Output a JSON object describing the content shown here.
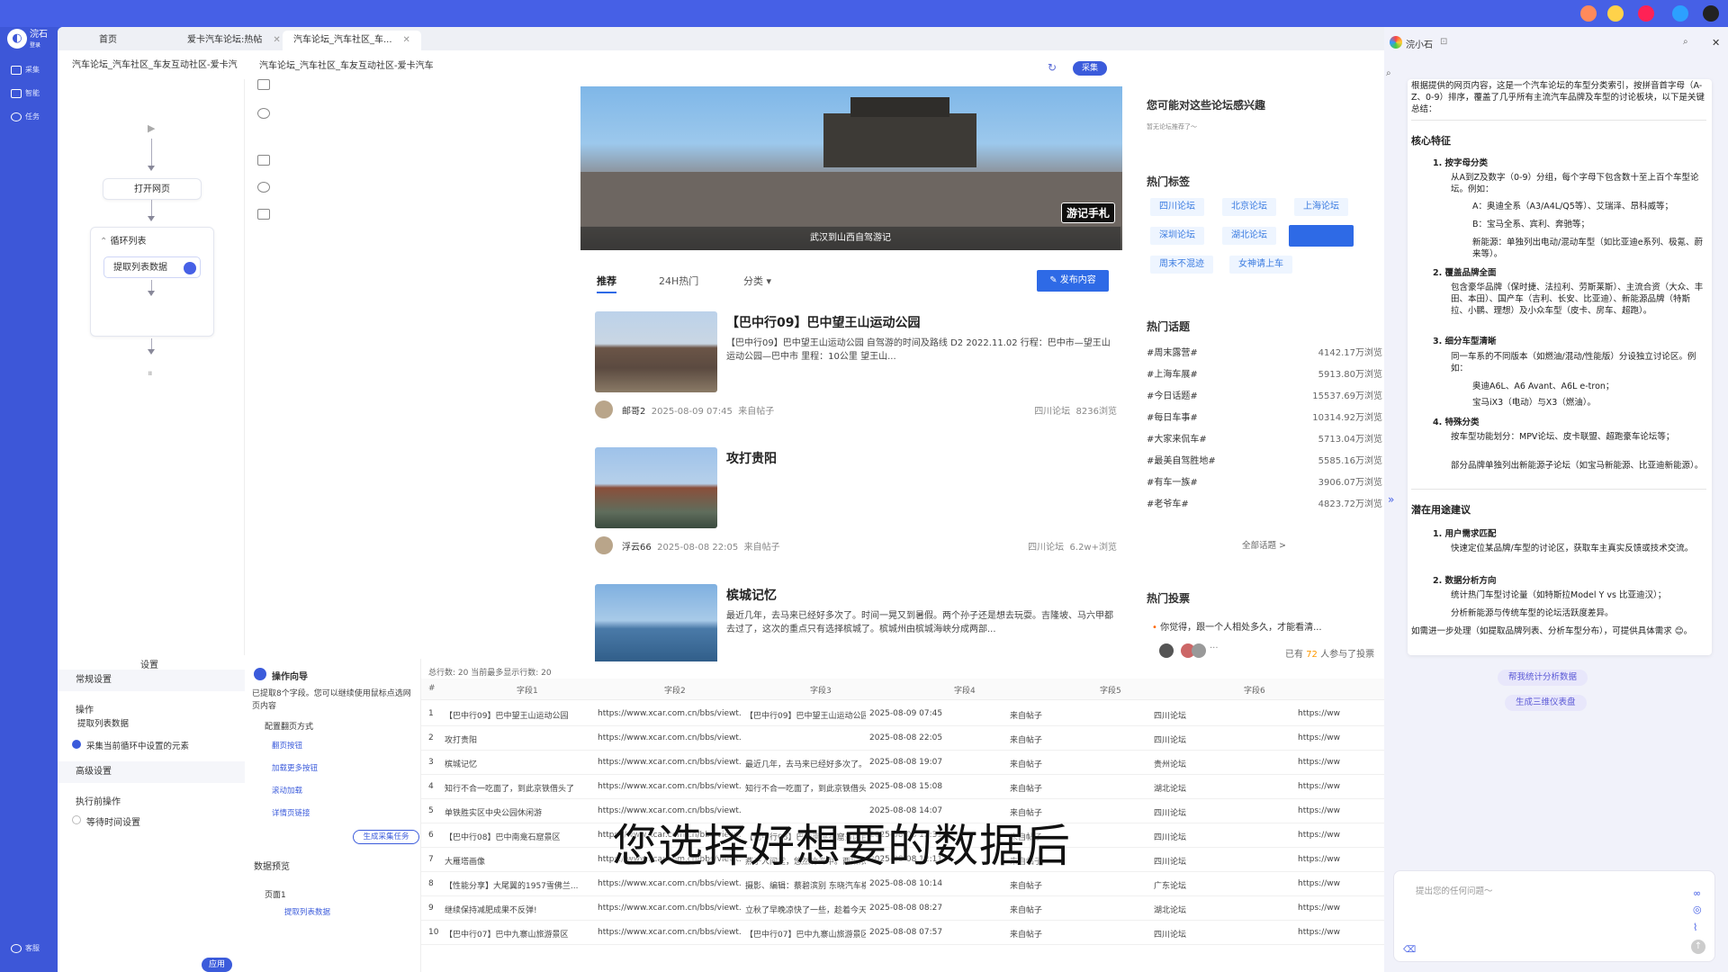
{
  "app": {
    "logo_text": "浣石",
    "logo_sub": "登录",
    "assistant_name": "浣小石"
  },
  "leftnav": {
    "items": [
      "采集",
      "智能",
      "任务"
    ],
    "help": "客服"
  },
  "tabs": [
    {
      "label": "首页"
    },
    {
      "label": "爱卡汽车论坛:热帖"
    },
    {
      "label": "汽车论坛_汽车社区_车..."
    }
  ],
  "address": {
    "left": "汽车论坛_汽车社区_车友互动社区-爱卡汽",
    "main": "汽车论坛_汽车社区_车友互动社区-爱卡汽车",
    "collect_label": "采集"
  },
  "flow": {
    "open_page": "打开网页",
    "loop": "循环列表",
    "extract": "提取列表数据"
  },
  "settings": {
    "title": "设置",
    "general": "常规设置",
    "action_label": "操作",
    "action_value": "提取列表数据",
    "checkbox_label": "采集当前循环中设置的元素",
    "advanced": "高级设置",
    "before_action": "执行前操作",
    "wait_timeout": "等待时间设置",
    "apply": "应用"
  },
  "guide": {
    "title": "操作向导",
    "desc": "已提取8个字段。您可以继续使用鼠标点选网页内容",
    "pagination_title": "配置翻页方式",
    "options": [
      "翻页按钮",
      "加载更多按钮",
      "滚动加载",
      "详情页链接"
    ],
    "generate": "生成采集任务",
    "data_preview": "数据预览",
    "page1": "页面1",
    "extract_list": "提取列表数据"
  },
  "banner": {
    "caption": "武汉到山西自驾游记",
    "tag": "游记手札"
  },
  "feed": {
    "tabs": [
      "推荐",
      "24H热门",
      "分类"
    ],
    "publish": "发布内容",
    "posts": [
      {
        "title": "【巴中行09】巴中望王山运动公园",
        "desc": "【巴中行09】巴中望王山运动公园 自驾游的时间及路线 D2 2022.11.02 行程：巴中市—望王山运动公园—巴中市 里程：10公里 望王山...",
        "author": "邮哥2",
        "time": "2025-08-09 07:45",
        "source": "来自帖子",
        "forum": "四川论坛",
        "views": "8236浏览"
      },
      {
        "title": "攻打贵阳",
        "desc": "",
        "author": "浮云66",
        "time": "2025-08-08 22:05",
        "source": "来自帖子",
        "forum": "四川论坛",
        "views": "6.2w+浏览"
      },
      {
        "title": "槟城记忆",
        "desc": "最近几年，去马来已经好多次了。时间一晃又到暑假。两个孙子还是想去玩耍。吉隆坡、马六甲都去过了，这次的重点只有选择槟城了。槟城州由槟城海峡分成两部...",
        "author": "",
        "time": "",
        "source": "",
        "forum": "",
        "views": ""
      }
    ]
  },
  "sidebar": {
    "interest_title": "您可能对这些论坛感兴趣",
    "interest_sub": "暂无论坛推荐了～",
    "hot_tags_title": "热门标签",
    "hot_tags": [
      "四川论坛",
      "北京论坛",
      "上海论坛",
      "深圳论坛",
      "湖北论坛",
      "",
      "周末不混迹",
      "女神请上车"
    ],
    "hot_topics_title": "热门话题",
    "topics": [
      {
        "name": "#周末露营#",
        "count": "4142.17万浏览"
      },
      {
        "name": "#上海车展#",
        "count": "5913.80万浏览"
      },
      {
        "name": "#今日话题#",
        "count": "15537.69万浏览"
      },
      {
        "name": "#每日车事#",
        "count": "10314.92万浏览"
      },
      {
        "name": "#大家来侃车#",
        "count": "5713.04万浏览"
      },
      {
        "name": "#最美自驾胜地#",
        "count": "5585.16万浏览"
      },
      {
        "name": "#有车一族#",
        "count": "3906.07万浏览"
      },
      {
        "name": "#老爷车#",
        "count": "4823.72万浏览"
      }
    ],
    "all_topics": "全部话题 >",
    "vote_title": "热门投票",
    "vote_question": "你觉得，跟一个人相处多久，才能看清...",
    "vote_count_prefix": "已有",
    "vote_count": "72",
    "vote_count_suffix": "人参与了投票"
  },
  "table": {
    "summary": "总行数: 20   当前最多显示行数: 20",
    "headers": [
      "#",
      "字段1",
      "字段2",
      "字段3",
      "字段4",
      "字段5",
      "字段6"
    ],
    "rows": [
      [
        "1",
        "【巴中行09】巴中望王山运动公园",
        "https://www.xcar.com.cn/bbs/viewt...",
        "【巴中行09】巴中望王山运动公园自...",
        "2025-08-09 07:45",
        "来自帖子",
        "四川论坛",
        "https://ww"
      ],
      [
        "2",
        "攻打贵阳",
        "https://www.xcar.com.cn/bbs/viewt...",
        "",
        "2025-08-08 22:05",
        "来自帖子",
        "四川论坛",
        "https://ww"
      ],
      [
        "3",
        "槟城记忆",
        "https://www.xcar.com.cn/bbs/viewt...",
        "最近几年，去马来已经好多次了。时...",
        "2025-08-08 19:07",
        "来自帖子",
        "贵州论坛",
        "https://ww"
      ],
      [
        "4",
        "知行不合一吃面了，到此京铁借头了",
        "https://www.xcar.com.cn/bbs/viewt...",
        "知行不合一吃面了，到此京铁借头了",
        "2025-08-08 15:08",
        "来自帖子",
        "湖北论坛",
        "https://ww"
      ],
      [
        "5",
        "单铁胜实区中央公园休闲游",
        "https://www.xcar.com.cn/bbs/viewt...",
        "",
        "2025-08-08 14:07",
        "来自帖子",
        "四川论坛",
        "https://ww"
      ],
      [
        "6",
        "【巴中行08】巴中南龛石窟景区",
        "https://www.xcar.com.cn/bbs/viewt...",
        "【巴中行08】巴中南龛石窟景区自驾...",
        "2025-08-08 12:31",
        "来自帖子",
        "四川论坛",
        "https://ww"
      ],
      [
        "7",
        "大雁塔画像",
        "https://www.xcar.com.cn/bbs/viewt...",
        "燕子人间堂，悠然竹海中。西阳浓墨...",
        "2025-08-08 12:11",
        "来自帖子",
        "四川论坛",
        "https://ww"
      ],
      [
        "8",
        "【性能分享】大尾翼的1957雪佛兰...",
        "https://www.xcar.com.cn/bbs/viewt...",
        "摄影、编辑：蔡碧滨别 东晓汽车横...",
        "2025-08-08 10:14",
        "来自帖子",
        "广东论坛",
        "https://ww"
      ],
      [
        "9",
        "继续保持减肥成果不反弹!",
        "https://www.xcar.com.cn/bbs/viewt...",
        "立秋了早晚凉快了一些，趁着今天阴...",
        "2025-08-08 08:27",
        "来自帖子",
        "湖北论坛",
        "https://ww"
      ],
      [
        "10",
        "【巴中行07】巴中九寨山旅游景区",
        "https://www.xcar.com.cn/bbs/viewt...",
        "【巴中行07】巴中九寨山旅游景区自...",
        "2025-08-08 07:57",
        "来自帖子",
        "四川论坛",
        "https://ww"
      ]
    ]
  },
  "subtitle": "您选择好想要的数据后",
  "ai": {
    "intro": "根据提供的网页内容，这是一个汽车论坛的车型分类索引，按拼音首字母（A-Z、0-9）排序，覆盖了几乎所有主流汽车品牌及车型的讨论板块，以下是关键总结：",
    "core_title": "核心特征",
    "s1": "1. 按字母分类",
    "s1a": "从A到Z及数字（0-9）分组，每个字母下包含数十至上百个车型论坛。例如：",
    "s1b": "A：奥迪全系（A3/A4L/Q5等）、艾瑞泽、昂科威等；",
    "s1c": "B：宝马全系、宾利、奔驰等；",
    "s1d": "新能源：单独列出电动/混动车型（如比亚迪e系列、极氪、蔚来等）。",
    "s2": "2. 覆盖品牌全面",
    "s2a": "包含豪华品牌（保时捷、法拉利、劳斯莱斯）、主流合资（大众、丰田、本田）、国产车（吉利、长安、比亚迪）、新能源品牌（特斯拉、小鹏、理想）及小众车型（皮卡、房车、超跑）。",
    "s3": "3. 细分车型清晰",
    "s3a": "同一车系的不同版本（如燃油/混动/性能版）分设独立讨论区。例如：",
    "s3b": "奥迪A6L、A6 Avant、A6L e-tron；",
    "s3c": "宝马iX3（电动）与X3（燃油）。",
    "s4": "4. 特殊分类",
    "s4a": "按车型功能划分：MPV论坛、皮卡联盟、超跑豪车论坛等；",
    "s4b": "部分品牌单独列出新能源子论坛（如宝马新能源、比亚迪新能源）。",
    "use_title": "潜在用途建议",
    "u1": "1. 用户需求匹配",
    "u1a": "快速定位某品牌/车型的讨论区，获取车主真实反馈或技术交流。",
    "u2": "2. 数据分析方向",
    "u2a": "统计热门车型讨论量（如特斯拉Model Y vs 比亚迪汉）；",
    "u2b": "分析新能源与传统车型的论坛活跃度差异。",
    "outro": "如需进一步处理（如提取品牌列表、分析车型分布），可提供具体需求 😊。",
    "suggestions": [
      "帮我统计分析数据",
      "生成三维仪表盘"
    ],
    "input_placeholder": "提出您的任何问题～"
  },
  "colors": {
    "brand": "#3b5bdb",
    "accent": "#2e6ae6",
    "tag_bg": "#eef5ff"
  }
}
